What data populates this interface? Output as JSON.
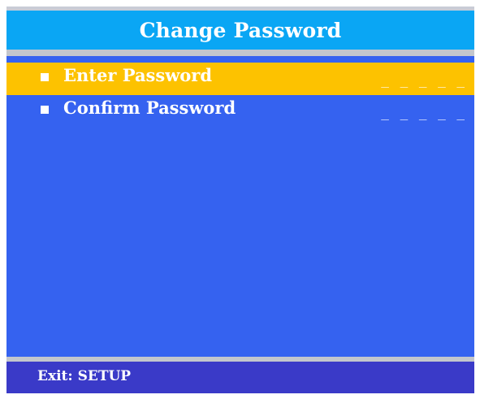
{
  "title": "Change Password",
  "menu": {
    "items": [
      {
        "label": "Enter Password",
        "value": "_ _ _ _ _",
        "selected": true
      },
      {
        "label": "Confirm Password",
        "value": "_ _ _ _ _",
        "selected": false
      }
    ]
  },
  "footer": {
    "hint": "Exit: SETUP"
  },
  "colors": {
    "background": "#3562f0",
    "title_bar": "#0aa6f4",
    "selection": "#fdc200",
    "footer": "#3a3ac8",
    "separator": "#c3c6cd"
  },
  "icons": {
    "bullet": "square-bullet-icon"
  }
}
